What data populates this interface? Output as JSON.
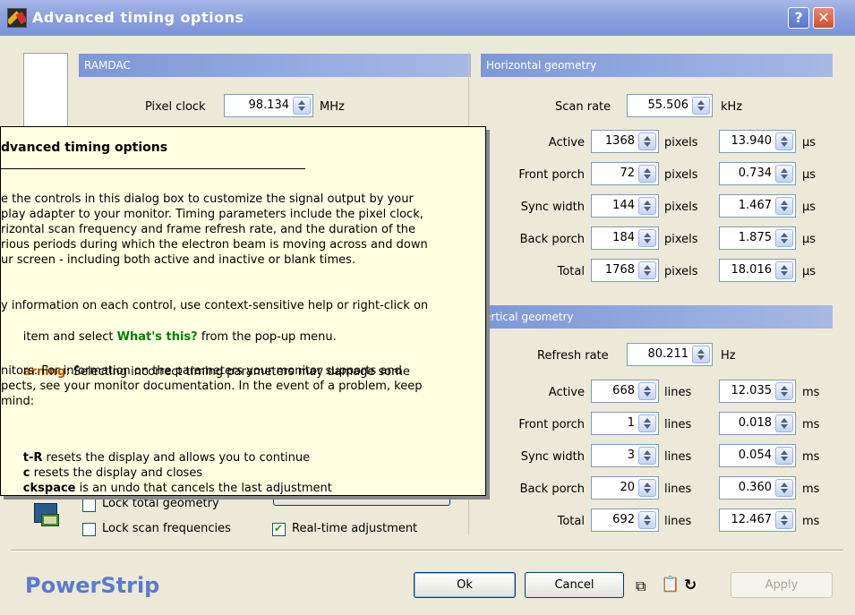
{
  "window": {
    "title": "Advanced timing options",
    "help_label": "?",
    "close_label": "✕"
  },
  "ramdac": {
    "header": "RAMDAC",
    "pixel_clock_label": "Pixel clock",
    "pixel_clock_value": "98.134",
    "pixel_clock_unit": "MHz"
  },
  "horizontal": {
    "header": "Horizontal geometry",
    "scan_rate_label": "Scan rate",
    "scan_rate_value": "55.506",
    "scan_rate_unit": "kHz",
    "rows": [
      {
        "label": "Active",
        "value": "1368",
        "unit": "pixels",
        "time": "13.940",
        "time_unit": "µs"
      },
      {
        "label": "Front porch",
        "value": "72",
        "unit": "pixels",
        "time": "0.734",
        "time_unit": "µs"
      },
      {
        "label": "Sync width",
        "value": "144",
        "unit": "pixels",
        "time": "1.467",
        "time_unit": "µs"
      },
      {
        "label": "Back porch",
        "value": "184",
        "unit": "pixels",
        "time": "1.875",
        "time_unit": "µs"
      },
      {
        "label": "Total",
        "value": "1768",
        "unit": "pixels",
        "time": "18.016",
        "time_unit": "µs"
      }
    ]
  },
  "vertical": {
    "header": "ertical geometry",
    "refresh_label": "Refresh rate",
    "refresh_value": "80.211",
    "refresh_unit": "Hz",
    "rows": [
      {
        "label": "Active",
        "value": "668",
        "unit": "lines",
        "time": "12.035",
        "time_unit": "ms"
      },
      {
        "label": "Front porch",
        "value": "1",
        "unit": "lines",
        "time": "0.018",
        "time_unit": "ms"
      },
      {
        "label": "Sync width",
        "value": "3",
        "unit": "lines",
        "time": "0.054",
        "time_unit": "ms"
      },
      {
        "label": "Back porch",
        "value": "20",
        "unit": "lines",
        "time": "0.360",
        "time_unit": "ms"
      },
      {
        "label": "Total",
        "value": "692",
        "unit": "lines",
        "time": "12.467",
        "time_unit": "ms"
      }
    ]
  },
  "options": {
    "lock_total_label": "Lock total geometry",
    "lock_scan_label": "Lock scan frequencies",
    "realtime_label": "Real-time adjustment",
    "lock_total_checked": false,
    "lock_scan_checked": false,
    "realtime_checked": true
  },
  "footer": {
    "brand": "PowerStrip",
    "ok_label": "Ok",
    "cancel_label": "Cancel",
    "apply_label": "Apply"
  },
  "tooltip": {
    "title": "dvanced timing options",
    "p1_lines": [
      "e the controls in this dialog box to customize the signal output by your",
      "play adapter to your monitor. Timing parameters include the pixel clock,",
      "rizontal scan frequency and frame refresh rate, and the duration of the",
      "rious periods during which the electron beam is moving across and down",
      "ur screen - including both active and inactive or blank times."
    ],
    "p2_line1": "y information on each control, use context-sensitive help or right-click on",
    "p2_line2_pre": "item and select ",
    "p2_line2_link": "What's this?",
    "p2_line2_post": " from the pop-up menu.",
    "p3_warn": "arning",
    "p3_line1_rest": ": Selecting incorrect timing parameters may damage some",
    "p3_lines": [
      "nitors. For information on the parameters your monitor supports and",
      "pects, see your monitor documentation. In the event of a problem, keep",
      "mind:"
    ],
    "k1_key": "t-R",
    "k1_text": " resets the display and allows you to continue",
    "k2_key": "c",
    "k2_text": " resets the display and closes",
    "k3_key": "ckspace",
    "k3_text": " is an undo that cancels the last adjustment"
  }
}
